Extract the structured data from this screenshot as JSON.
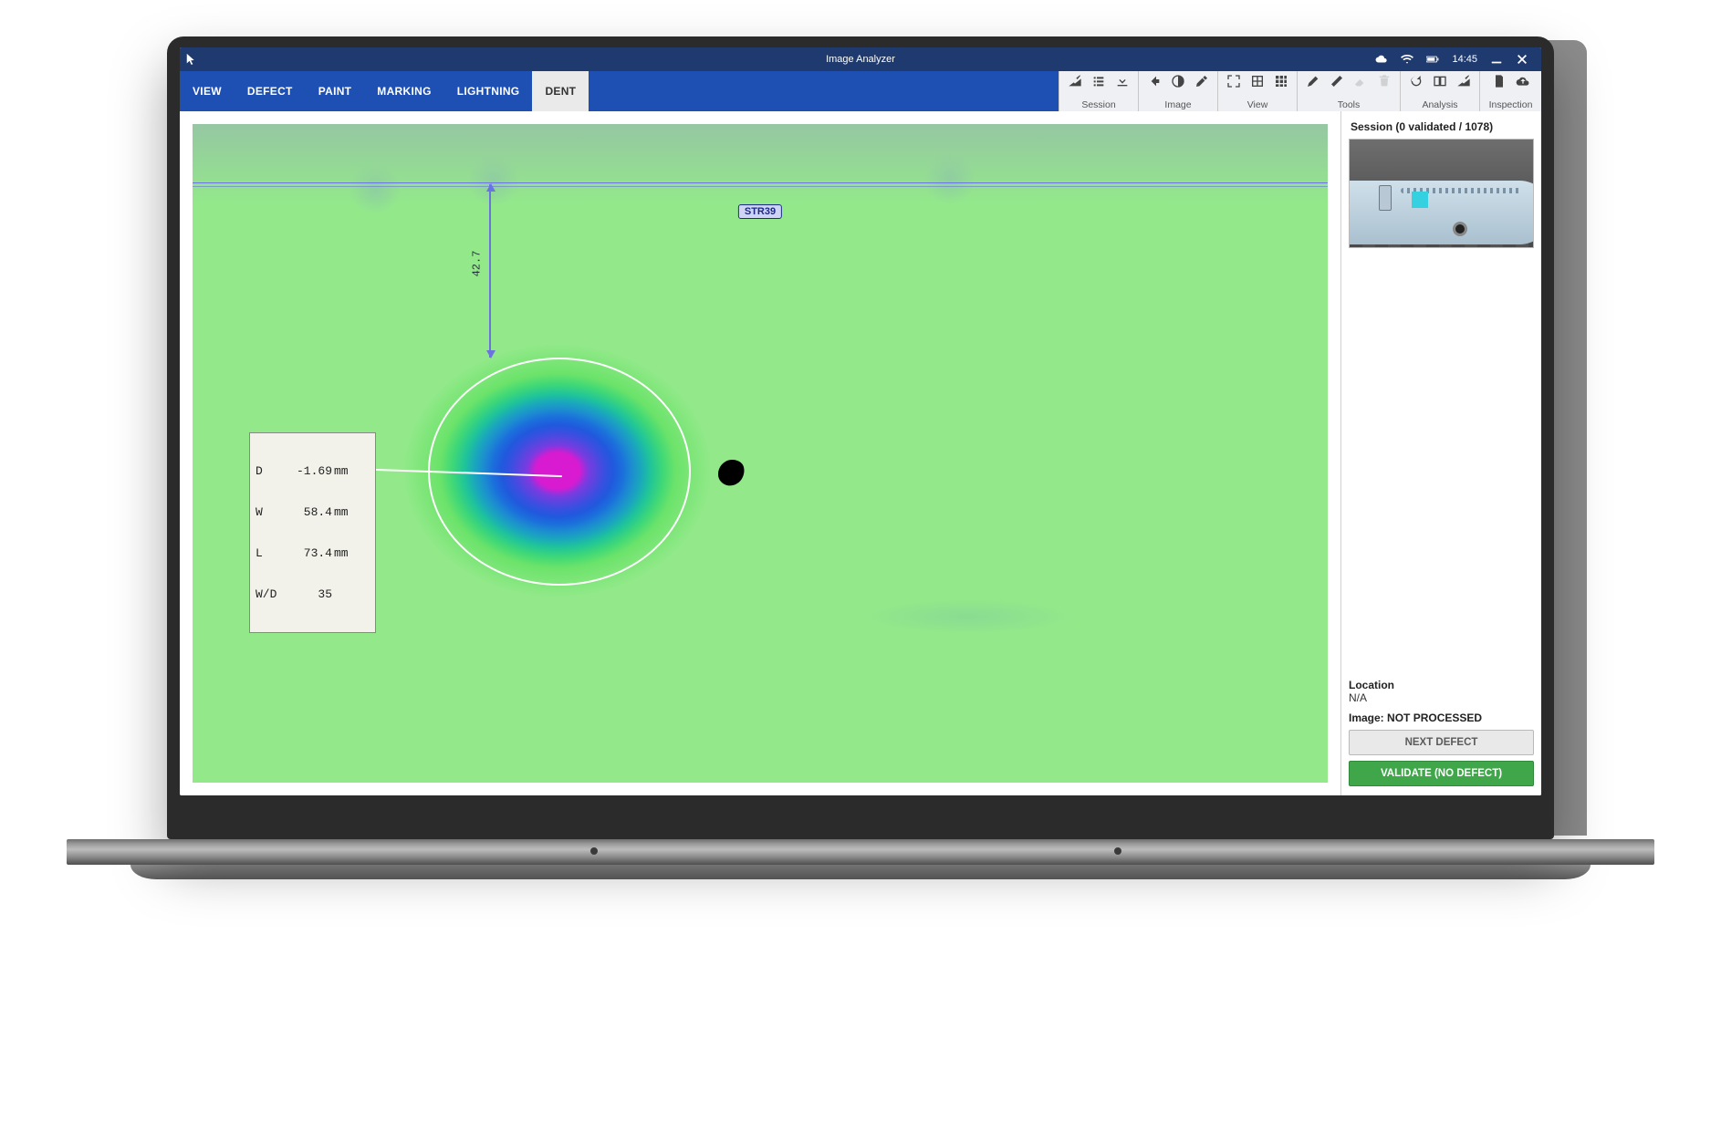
{
  "window": {
    "title": "Image Analyzer",
    "clock": "14:45"
  },
  "tabs": {
    "view": "VIEW",
    "defect": "DEFECT",
    "paint": "PAINT",
    "marking": "MARKING",
    "lightning": "LIGHTNING",
    "dent": "DENT",
    "active": "dent"
  },
  "tool_groups": {
    "session": "Session",
    "image": "Image",
    "view": "View",
    "tools": "Tools",
    "analysis": "Analysis",
    "inspection": "Inspection"
  },
  "canvas": {
    "structure_ref": "STR39",
    "distance_to_ref": "42.7",
    "dent": {
      "D": {
        "value": "-1.69",
        "unit": "mm"
      },
      "W": {
        "value": "58.4",
        "unit": "mm"
      },
      "L": {
        "value": "73.4",
        "unit": "mm"
      },
      "W/D": {
        "value": "35",
        "unit": ""
      }
    }
  },
  "side": {
    "session_label_prefix": "Session (",
    "validated_count": "0",
    "validated_word": "validated",
    "total_count": "1078",
    "session_label_suffix": ")",
    "location_label": "Location",
    "location_value": "N/A",
    "image_status_key": "Image:",
    "image_status_value": "NOT PROCESSED",
    "btn_next": "NEXT DEFECT",
    "btn_validate": "VALIDATE (NO DEFECT)"
  },
  "colors": {
    "titlebar": "#1f3a6e",
    "ribbon": "#1e4fb3",
    "validate_green": "#3fa64a"
  }
}
